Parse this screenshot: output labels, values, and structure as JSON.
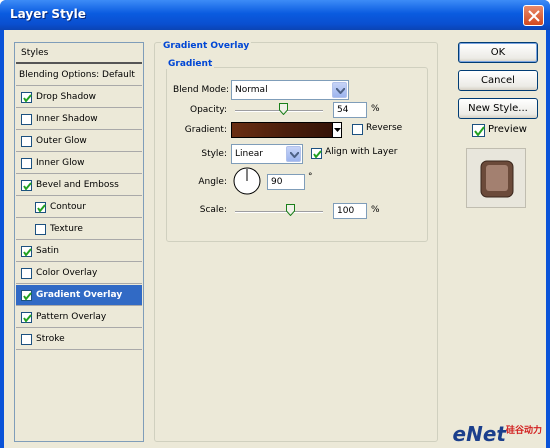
{
  "window": {
    "title": "Layer Style"
  },
  "styles_list": {
    "header": "Styles",
    "blending": "Blending Options: Default",
    "items": [
      {
        "label": "Drop Shadow",
        "checked": true
      },
      {
        "label": "Inner Shadow",
        "checked": false
      },
      {
        "label": "Outer Glow",
        "checked": false
      },
      {
        "label": "Inner Glow",
        "checked": false
      },
      {
        "label": "Bevel and Emboss",
        "checked": true
      },
      {
        "label": "Contour",
        "checked": true
      },
      {
        "label": "Texture",
        "checked": false
      },
      {
        "label": "Satin",
        "checked": true
      },
      {
        "label": "Color Overlay",
        "checked": false
      },
      {
        "label": "Gradient Overlay",
        "checked": true,
        "selected": true
      },
      {
        "label": "Pattern Overlay",
        "checked": true
      },
      {
        "label": "Stroke",
        "checked": false
      }
    ]
  },
  "panel": {
    "title": "Gradient Overlay",
    "subtitle": "Gradient",
    "blend_mode_label": "Blend Mode:",
    "blend_mode_value": "Normal",
    "opacity_label": "Opacity:",
    "opacity_value": "54",
    "opacity_unit": "%",
    "gradient_label": "Gradient:",
    "gradient_colors": [
      "#6a2e12",
      "#4a1e0c",
      "#351307"
    ],
    "reverse_label": "Reverse",
    "reverse_checked": false,
    "style_label": "Style:",
    "style_value": "Linear",
    "align_label": "Align with Layer",
    "align_checked": true,
    "angle_label": "Angle:",
    "angle_value": "90",
    "angle_unit": "°",
    "scale_label": "Scale:",
    "scale_value": "100",
    "scale_unit": "%"
  },
  "buttons": {
    "ok": "OK",
    "cancel": "Cancel",
    "new_style": "New Style...",
    "preview_label": "Preview",
    "preview_checked": true
  },
  "watermark": {
    "main": "eNet",
    "sub": "硅谷动力"
  }
}
